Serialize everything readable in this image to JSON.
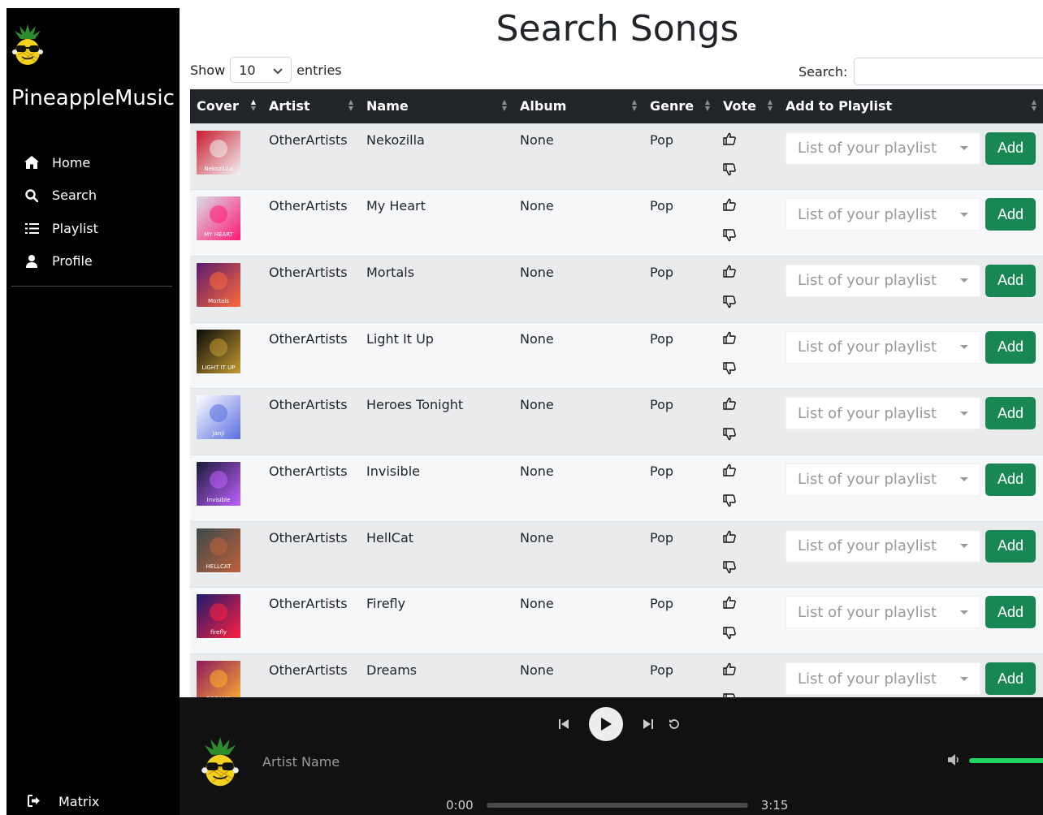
{
  "app": {
    "brand": "PineappleMusic"
  },
  "sidebar": {
    "items": [
      {
        "label": "Home",
        "icon": "home-icon"
      },
      {
        "label": "Search",
        "icon": "search-icon"
      },
      {
        "label": "Playlist",
        "icon": "list-icon"
      },
      {
        "label": "Profile",
        "icon": "user-icon"
      }
    ],
    "logout_label": "Matrix"
  },
  "page": {
    "title": "Search Songs"
  },
  "controls": {
    "show_label": "Show",
    "entries_value": "10",
    "entries_label": "entries",
    "search_label": "Search:",
    "search_value": ""
  },
  "table": {
    "headers": [
      "Cover",
      "Artist",
      "Name",
      "Album",
      "Genre",
      "Vote",
      "Add to Playlist"
    ],
    "playlist_placeholder": "List of your playlist",
    "add_label": "Add",
    "rows": [
      {
        "artist": "OtherArtists",
        "name": "Nekozilla",
        "album": "None",
        "genre": "Pop",
        "cover_colors": [
          "#c81a2e",
          "#f2f2f2"
        ]
      },
      {
        "artist": "OtherArtists",
        "name": "My Heart",
        "album": "None",
        "genre": "Pop",
        "cover_colors": [
          "#d8dde6",
          "#ff1a75"
        ]
      },
      {
        "artist": "OtherArtists",
        "name": "Mortals",
        "album": "None",
        "genre": "Pop",
        "cover_colors": [
          "#5a1a6e",
          "#ff6a3a"
        ]
      },
      {
        "artist": "OtherArtists",
        "name": "Light It Up",
        "album": "None",
        "genre": "Pop",
        "cover_colors": [
          "#0a0a0a",
          "#c49a30"
        ]
      },
      {
        "artist": "OtherArtists",
        "name": "Heroes Tonight",
        "album": "None",
        "genre": "Pop",
        "cover_colors": [
          "#ffffff",
          "#5a6ee0"
        ]
      },
      {
        "artist": "OtherArtists",
        "name": "Invisible",
        "album": "None",
        "genre": "Pop",
        "cover_colors": [
          "#1a1a3a",
          "#c060ff"
        ]
      },
      {
        "artist": "OtherArtists",
        "name": "HellCat",
        "album": "None",
        "genre": "Pop",
        "cover_colors": [
          "#3a4a4a",
          "#c0603a"
        ]
      },
      {
        "artist": "OtherArtists",
        "name": "Firefly",
        "album": "None",
        "genre": "Pop",
        "cover_colors": [
          "#1a1a6e",
          "#ff2040"
        ]
      },
      {
        "artist": "OtherArtists",
        "name": "Dreams",
        "album": "None",
        "genre": "Pop",
        "cover_colors": [
          "#8a1a5e",
          "#ffb030"
        ]
      }
    ]
  },
  "cover_text": [
    "NekoziLLa",
    "MY HEART",
    "Mortals",
    "LIGHT IT UP",
    "Janji",
    "Invisible",
    "HELLCAT",
    "firefly",
    "DREAMS"
  ],
  "player": {
    "artist_name": "Artist Name",
    "current_time": "0:00",
    "duration": "3:15",
    "progress": 0,
    "volume": 1.0
  },
  "colors": {
    "sidebar_bg": "#000000",
    "table_header_bg": "#212529",
    "add_button": "#198754",
    "player_bg": "#111111",
    "volume_accent": "#1ed760"
  }
}
